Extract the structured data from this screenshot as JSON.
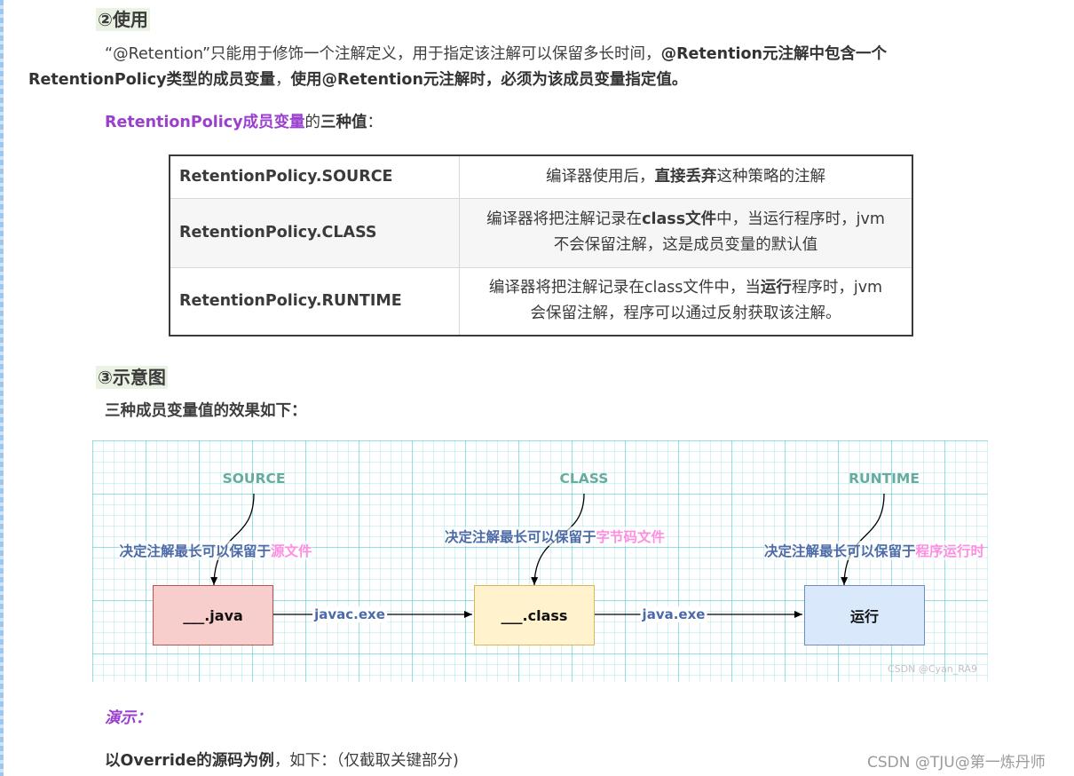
{
  "section2": {
    "title": "②使用",
    "p1_a": "“@Retention”只能用于修饰一个注解定义，用于指定该注解可以保留多长时间，",
    "p1_b": "@Retention元注解中包含一个",
    "p2_a": "RetentionPolicy类型的成员变量",
    "p2_b": "，",
    "p2_c": "使用@Retention元注解时，必须为该成员变量指定值。",
    "values_purple": "RetentionPolicy成员变量",
    "values_mid": "的",
    "values_bold": "三种值",
    "values_colon": "："
  },
  "table": {
    "rows": [
      {
        "policy": "RetentionPolicy.SOURCE",
        "d1": "编译器使用后，",
        "d1b": "直接丢弃",
        "d1c": "这种策略的注解",
        "d2": ""
      },
      {
        "policy": "RetentionPolicy.CLASS",
        "d1": "编译器将把注解记录在",
        "d1b": "class文件",
        "d1c": "中，当运行程序时，jvm",
        "d2": "不会保留注解，这是成员变量的默认值"
      },
      {
        "policy": "RetentionPolicy.RUNTIME",
        "d1": "编译器将把注解记录在class文件中，当",
        "d1b": "运行",
        "d1c": "程序时，jvm",
        "d2": "会保留注解，程序可以通过反射获取该注解。"
      }
    ]
  },
  "section3": {
    "title": "③示意图",
    "subtitle": "三种成员变量值的效果如下："
  },
  "diagram": {
    "stages": [
      {
        "label": "SOURCE",
        "desc": "决定注解最长可以保留于",
        "desc_pink": "源文件"
      },
      {
        "label": "CLASS",
        "desc": "决定注解最长可以保留于",
        "desc_pink": "字节码文件"
      },
      {
        "label": "RUNTIME",
        "desc": "决定注解最长可以保留于",
        "desc_pink": "程序运行时"
      }
    ],
    "boxes": [
      {
        "label": "___.java",
        "fill": "#f8cecc",
        "stroke": "#b85450"
      },
      {
        "label": "___.class",
        "fill": "#fff2cc",
        "stroke": "#d6b656"
      },
      {
        "label": "运行",
        "fill": "#dae8fc",
        "stroke": "#6c8ebf"
      }
    ],
    "edges": [
      "javac.exe",
      "java.exe"
    ],
    "watermark": "CSDN @Cyan_RA9"
  },
  "demo": {
    "label": "演示：",
    "text_bold": "以Override的源码为例",
    "text_rest": "，如下：（仅截取关键部分)"
  },
  "page_watermark": "CSDN @TJU@第一炼丹师"
}
